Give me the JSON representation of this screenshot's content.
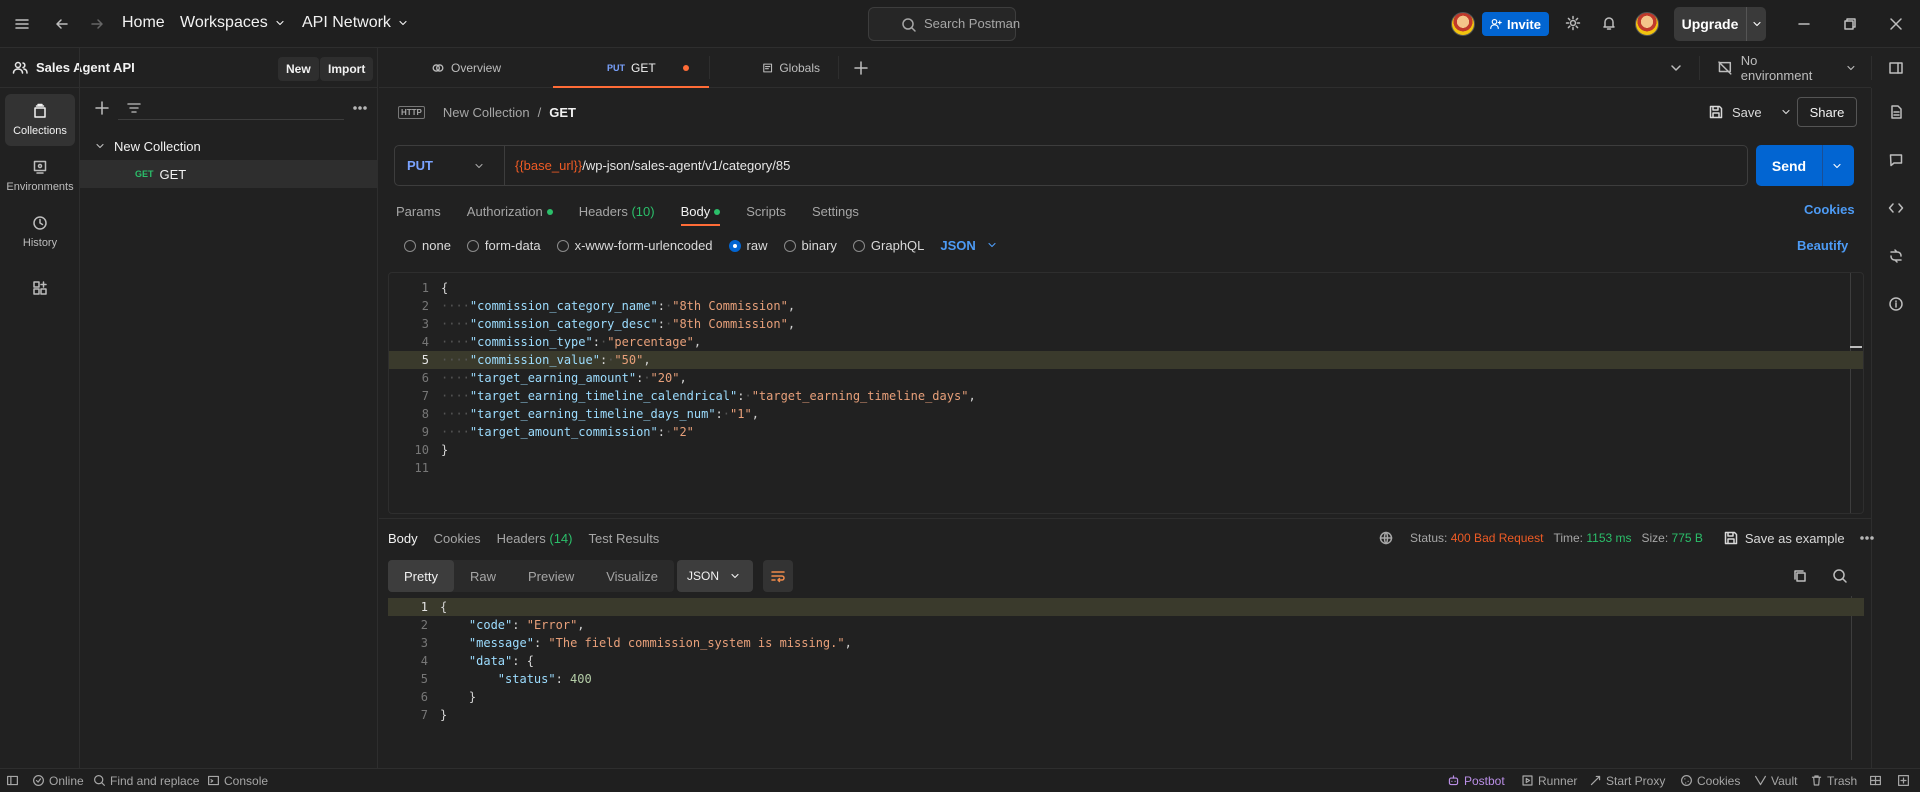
{
  "topbar": {
    "home": "Home",
    "workspaces": "Workspaces",
    "api_network": "API Network",
    "search_placeholder": "Search Postman",
    "invite": "Invite",
    "upgrade": "Upgrade"
  },
  "workspace": {
    "name": "Sales Agent API",
    "new_label": "New",
    "import_label": "Import"
  },
  "rail": {
    "items": [
      {
        "label": "Collections",
        "icon": "collections-icon",
        "active": true
      },
      {
        "label": "Environments",
        "icon": "environments-icon"
      },
      {
        "label": "History",
        "icon": "history-icon"
      }
    ]
  },
  "sidebar": {
    "collection": "New Collection",
    "request_method": "GET",
    "request_name": "GET"
  },
  "tabs": {
    "overview": "Overview",
    "active_method": "PUT",
    "active_name": "GET",
    "globals": "Globals",
    "environment": "No environment"
  },
  "request": {
    "breadcrumb_parent": "New Collection",
    "breadcrumb_sep": "/",
    "breadcrumb_current": "GET",
    "save_label": "Save",
    "share_label": "Share",
    "method": "PUT",
    "url_var": "{{base_url}}",
    "url_path": "/wp-json/sales-agent/v1/category/85",
    "send_label": "Send",
    "tabs": {
      "params": "Params",
      "authorization": "Authorization",
      "headers": "Headers",
      "headers_count": "(10)",
      "body": "Body",
      "scripts": "Scripts",
      "settings": "Settings"
    },
    "cookies_label": "Cookies",
    "body_options": [
      "none",
      "form-data",
      "x-www-form-urlencoded",
      "raw",
      "binary",
      "GraphQL"
    ],
    "body_selected": "raw",
    "body_format": "JSON",
    "beautify_label": "Beautify",
    "body_lines": [
      {
        "n": "1",
        "text": "{"
      },
      {
        "n": "2",
        "key": "\"commission_category_name\"",
        "val": "\"8th Commission\"",
        "tail": ","
      },
      {
        "n": "3",
        "key": "\"commission_category_desc\"",
        "val": "\"8th Commission\"",
        "tail": ","
      },
      {
        "n": "4",
        "key": "\"commission_type\"",
        "val": "\"percentage\"",
        "tail": ","
      },
      {
        "n": "5",
        "key": "\"commission_value\"",
        "val": "\"50\"",
        "tail": ","
      },
      {
        "n": "6",
        "key": "\"target_earning_amount\"",
        "val": "\"20\"",
        "tail": ","
      },
      {
        "n": "7",
        "key": "\"target_earning_timeline_calendrical\"",
        "val": "\"target_earning_timeline_days\"",
        "tail": ","
      },
      {
        "n": "8",
        "key": "\"target_earning_timeline_days_num\"",
        "val": "\"1\"",
        "tail": ","
      },
      {
        "n": "9",
        "key": "\"target_amount_commission\"",
        "val": "\"2\"",
        "tail": ""
      },
      {
        "n": "10",
        "text": "}"
      },
      {
        "n": "11",
        "text": ""
      }
    ]
  },
  "response": {
    "tabs": {
      "body": "Body",
      "cookies": "Cookies",
      "headers": "Headers",
      "headers_count": "(14)",
      "test_results": "Test Results"
    },
    "status_label": "Status:",
    "status_value": "400 Bad Request",
    "time_label": "Time:",
    "time_value": "1153 ms",
    "size_label": "Size:",
    "size_value": "775 B",
    "save_example": "Save as example",
    "views": [
      "Pretty",
      "Raw",
      "Preview",
      "Visualize"
    ],
    "format": "JSON",
    "body_lines": [
      {
        "n": "1",
        "text": "{"
      },
      {
        "n": "2",
        "indent": 1,
        "key": "\"code\"",
        "val": "\"Error\"",
        "tail": ","
      },
      {
        "n": "3",
        "indent": 1,
        "key": "\"message\"",
        "val": "\"The field commission_system is missing.\"",
        "tail": ","
      },
      {
        "n": "4",
        "indent": 1,
        "key": "\"data\"",
        "val": "{",
        "tail": ""
      },
      {
        "n": "5",
        "indent": 2,
        "key": "\"status\"",
        "num": "400",
        "tail": ""
      },
      {
        "n": "6",
        "indent": 1,
        "text": "}"
      },
      {
        "n": "7",
        "text": "}"
      }
    ]
  },
  "statusbar": {
    "online": "Online",
    "find_replace": "Find and replace",
    "console": "Console",
    "postbot": "Postbot",
    "runner": "Runner",
    "start_proxy": "Start Proxy",
    "cookies": "Cookies",
    "vault": "Vault",
    "trash": "Trash"
  },
  "colors": {
    "accent": "#ff6c37",
    "primary": "#0265d2",
    "success": "#2bbf6a",
    "error": "#ef5b25"
  }
}
